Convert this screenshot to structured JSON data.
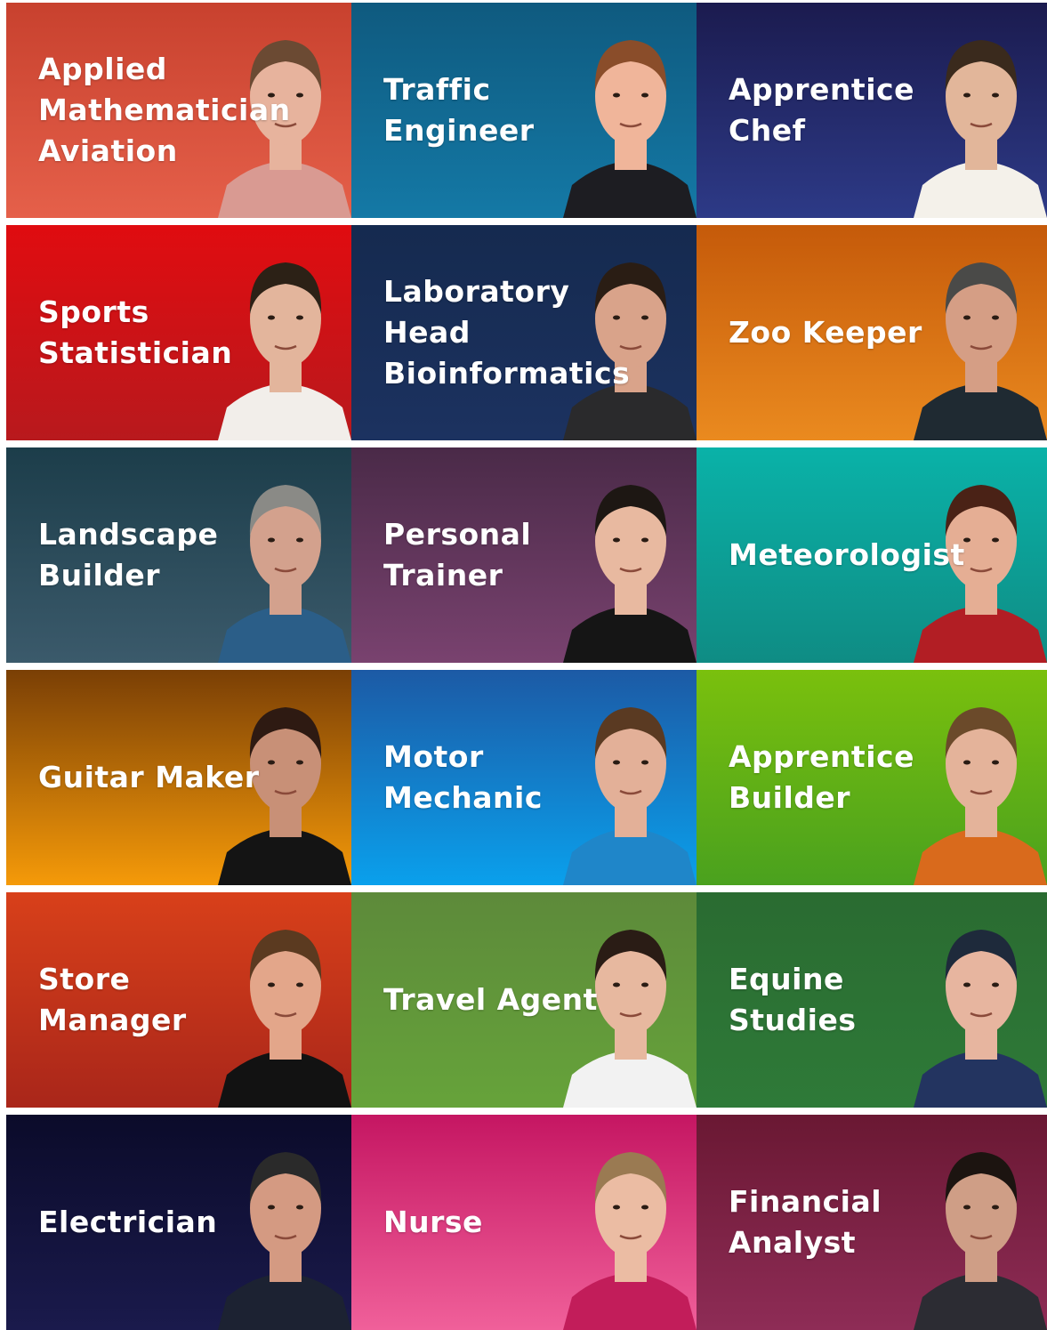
{
  "tiles": [
    {
      "lines": [
        "Applied",
        "Mathematician",
        "Aviation"
      ],
      "bg": [
        "#c8412e",
        "#e5604a"
      ],
      "skin": "#e7b39d",
      "hair": "#6b4a33",
      "shirt": "#d99a92"
    },
    {
      "lines": [
        "Traffic",
        "Engineer"
      ],
      "bg": [
        "#0f5a7f",
        "#1479a6"
      ],
      "skin": "#f0b59a",
      "hair": "#8a4d2a",
      "shirt": "#1d1d22"
    },
    {
      "lines": [
        "Apprentice",
        "Chef"
      ],
      "bg": [
        "#1b1b4f",
        "#2d3a87"
      ],
      "skin": "#e2b69a",
      "hair": "#3a2a1d",
      "shirt": "#f4f1ea"
    },
    {
      "lines": [
        "Sports",
        "Statistician"
      ],
      "bg": [
        "#e00c10",
        "#b8191d"
      ],
      "skin": "#e3b59c",
      "hair": "#2c2116",
      "shirt": "#f2eeea"
    },
    {
      "lines": [
        "Laboratory",
        "Head",
        "Bioinformatics"
      ],
      "bg": [
        "#152a4f",
        "#1c3260"
      ],
      "skin": "#d9a38a",
      "hair": "#2a1d14",
      "shirt": "#2a2a2c"
    },
    {
      "lines": [
        "Zoo Keeper"
      ],
      "bg": [
        "#c55a0a",
        "#ea8a1f"
      ],
      "skin": "#d59e85",
      "hair": "#4a4a48",
      "shirt": "#1f2a32"
    },
    {
      "lines": [
        "Landscape",
        "Builder"
      ],
      "bg": [
        "#1c3d4a",
        "#3b5a6b"
      ],
      "skin": "#d3a18d",
      "hair": "#8a8a86",
      "shirt": "#2b5e88"
    },
    {
      "lines": [
        "Personal",
        "Trainer"
      ],
      "bg": [
        "#4a2a48",
        "#79426f"
      ],
      "skin": "#e8b9a0",
      "hair": "#1d1713",
      "shirt": "#151515"
    },
    {
      "lines": [
        "Meteorologist"
      ],
      "bg": [
        "#0ab2a8",
        "#0f8c84"
      ],
      "skin": "#e5ae94",
      "hair": "#4a2216",
      "shirt": "#b21e24"
    },
    {
      "lines": [
        "Guitar Maker"
      ],
      "bg": [
        "#7a3f05",
        "#f59a09"
      ],
      "skin": "#c89077",
      "hair": "#2e1a12",
      "shirt": "#141414"
    },
    {
      "lines": [
        "Motor",
        "Mechanic"
      ],
      "bg": [
        "#1c5aa5",
        "#0aa0ec"
      ],
      "skin": "#e3b098",
      "hair": "#5a3a22",
      "shirt": "#1f86c9"
    },
    {
      "lines": [
        "Apprentice",
        "Builder"
      ],
      "bg": [
        "#7ac00d",
        "#4aa11e"
      ],
      "skin": "#e4b39a",
      "hair": "#6b4a2a",
      "shirt": "#d96a1c"
    },
    {
      "lines": [
        "Store",
        "Manager"
      ],
      "bg": [
        "#d8401a",
        "#a9261a"
      ],
      "skin": "#e3a68a",
      "hair": "#5b3a20",
      "shirt": "#121212"
    },
    {
      "lines": [
        "Travel Agent"
      ],
      "bg": [
        "#5d8a3a",
        "#66a33a"
      ],
      "skin": "#e7b89f",
      "hair": "#2a1c15",
      "shirt": "#f2f2f2"
    },
    {
      "lines": [
        "Equine",
        "Studies"
      ],
      "bg": [
        "#2a6b31",
        "#2e7a38"
      ],
      "skin": "#e7b59f",
      "hair": "#1e2a3b",
      "shirt": "#233460"
    },
    {
      "lines": [
        "Electrician"
      ],
      "bg": [
        "#0b0b2a",
        "#1a1a4c"
      ],
      "skin": "#d49a82",
      "hair": "#2a2a2a",
      "shirt": "#1c2232"
    },
    {
      "lines": [
        "Nurse"
      ],
      "bg": [
        "#c51662",
        "#f0609a"
      ],
      "skin": "#ebbca3",
      "hair": "#9a7a52",
      "shirt": "#c21d5a"
    },
    {
      "lines": [
        "Financial",
        "Analyst"
      ],
      "bg": [
        "#6a1833",
        "#8e2c56"
      ],
      "skin": "#cf9e86",
      "hair": "#1c1410",
      "shirt": "#2c2c33"
    }
  ]
}
